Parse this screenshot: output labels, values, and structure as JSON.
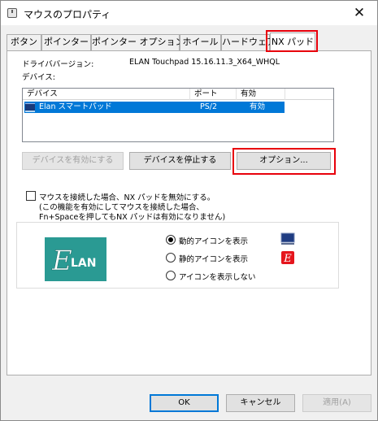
{
  "window": {
    "title": "マウスのプロパティ",
    "close_label": "✕"
  },
  "tabs": [
    {
      "label": "ボタン"
    },
    {
      "label": "ポインター"
    },
    {
      "label": "ポインター オプション"
    },
    {
      "label": "ホイール"
    },
    {
      "label": "ハードウェア"
    },
    {
      "label": "NX パッド",
      "active": true
    }
  ],
  "driver": {
    "label": "ドライババージョン:",
    "value": "ELAN Touchpad 15.16.11.3_X64_WHQL"
  },
  "devices": {
    "label": "デバイス:",
    "columns": [
      "デバイス",
      "ポート",
      "有効"
    ],
    "rows": [
      {
        "device": "Elan スマートパッド",
        "port": "PS/2",
        "enabled": "有効"
      }
    ]
  },
  "buttons": {
    "enable": "デバイスを有効にする",
    "stop": "デバイスを停止する",
    "options": "オプション..."
  },
  "disable_option": {
    "line1": "マウスを接続した場合、NX パッドを無効にする。",
    "line2": "(この機能を有効にしてマウスを接続した場合、",
    "line3": "Fn+Spaceを押してもNX パッドは有効になりません)"
  },
  "logo": {
    "text": "LAN",
    "letter": "E"
  },
  "icon_options": [
    {
      "label": "動的アイコンを表示",
      "selected": true,
      "icon": "touchpad-dynamic-icon"
    },
    {
      "label": "静的アイコンを表示",
      "selected": false,
      "icon": "touchpad-static-icon"
    },
    {
      "label": "アイコンを表示しない",
      "selected": false
    }
  ],
  "footer": {
    "ok": "OK",
    "cancel": "キャンセル",
    "apply": "適用(A)"
  },
  "colors": {
    "highlight": "#0078d7",
    "callout": "#e8000b",
    "elan_green": "#2a9a93"
  }
}
